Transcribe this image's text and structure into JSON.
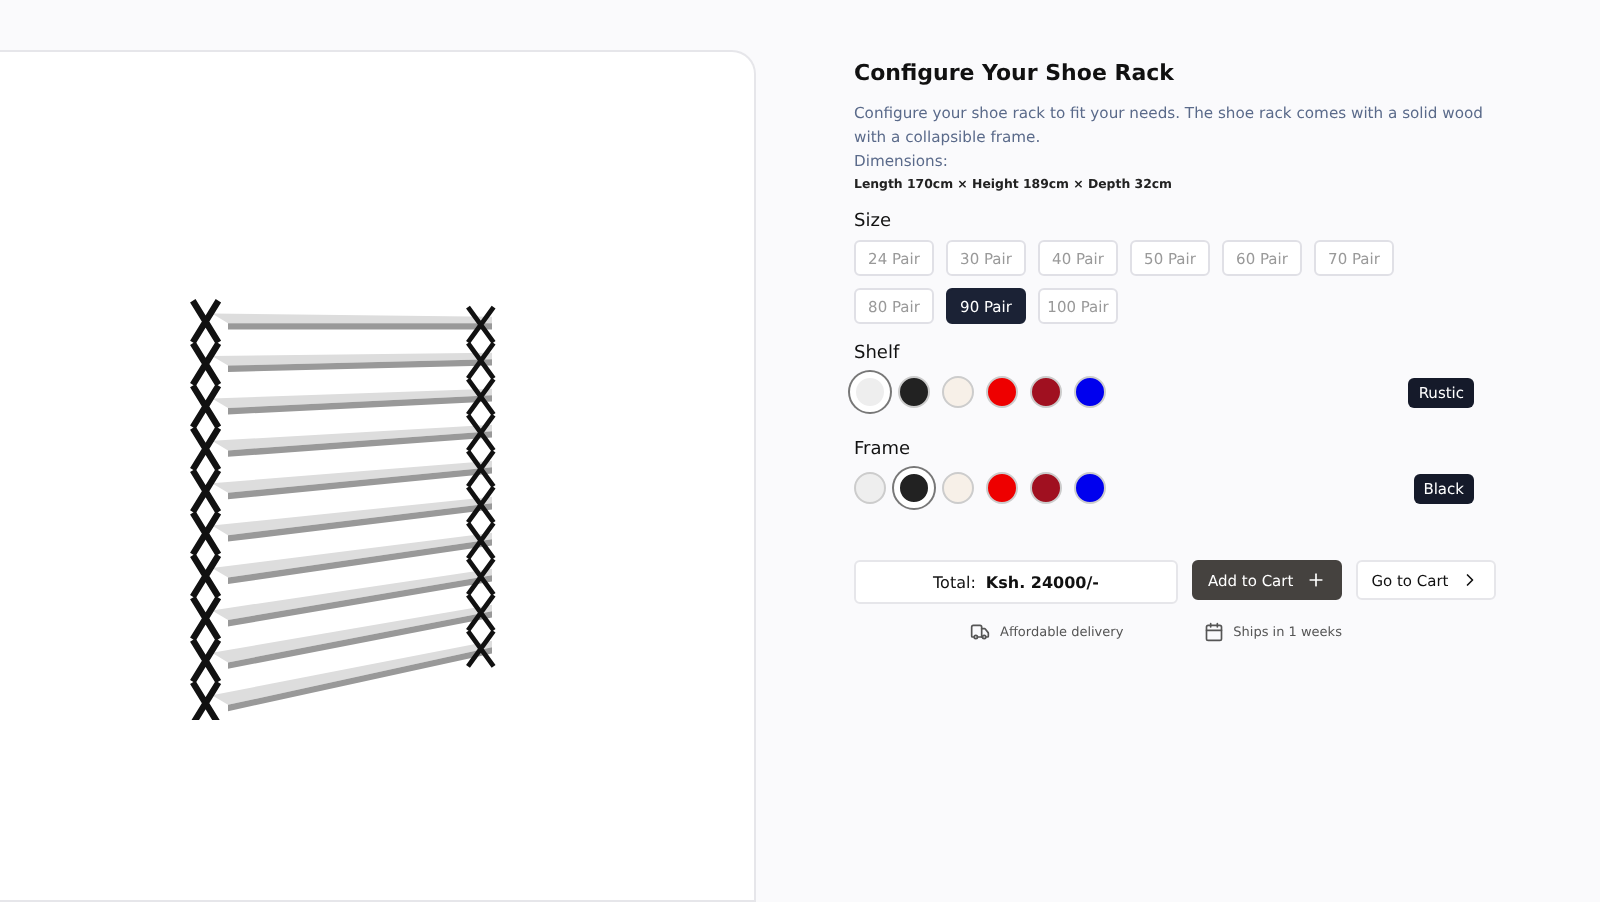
{
  "title": "Configure Your Shoe Rack",
  "description": "Configure your shoe rack to fit your needs. The shoe rack comes with a solid wood with a collapsible frame.",
  "dimensions_label": "Dimensions:",
  "dimensions": "Length 170cm × Height 189cm × Depth 32cm",
  "size": {
    "label": "Size",
    "options": [
      {
        "label": "24 Pair",
        "selected": false
      },
      {
        "label": "30 Pair",
        "selected": false
      },
      {
        "label": "40 Pair",
        "selected": false
      },
      {
        "label": "50 Pair",
        "selected": false
      },
      {
        "label": "60 Pair",
        "selected": false
      },
      {
        "label": "70 Pair",
        "selected": false
      },
      {
        "label": "80 Pair",
        "selected": false
      },
      {
        "label": "90 Pair",
        "selected": true
      },
      {
        "label": "100 Pair",
        "selected": false
      }
    ]
  },
  "color_groups": [
    {
      "label": "Shelf",
      "value": "Rustic",
      "swatches": [
        {
          "color": "#eeeeee",
          "selected": true
        },
        {
          "color": "#222222",
          "selected": false
        },
        {
          "color": "#f7f0e8",
          "selected": false
        },
        {
          "color": "#ee0000",
          "selected": false
        },
        {
          "color": "#a01020",
          "selected": false
        },
        {
          "color": "#0000ee",
          "selected": false
        }
      ]
    },
    {
      "label": "Frame",
      "value": "Black",
      "swatches": [
        {
          "color": "#eeeeee",
          "selected": false
        },
        {
          "color": "#222222",
          "selected": true
        },
        {
          "color": "#f7f0e8",
          "selected": false
        },
        {
          "color": "#ee0000",
          "selected": false
        },
        {
          "color": "#a01020",
          "selected": false
        },
        {
          "color": "#0000ee",
          "selected": false
        }
      ]
    }
  ],
  "total_label": "Total:",
  "total_value": "Ksh. 24000/-",
  "add_to_cart": "Add to Cart",
  "go_to_cart": "Go to Cart",
  "features": [
    {
      "kind": "delivery",
      "text": "Affordable delivery"
    },
    {
      "kind": "shipping",
      "text": "Ships in 1 weeks"
    }
  ]
}
